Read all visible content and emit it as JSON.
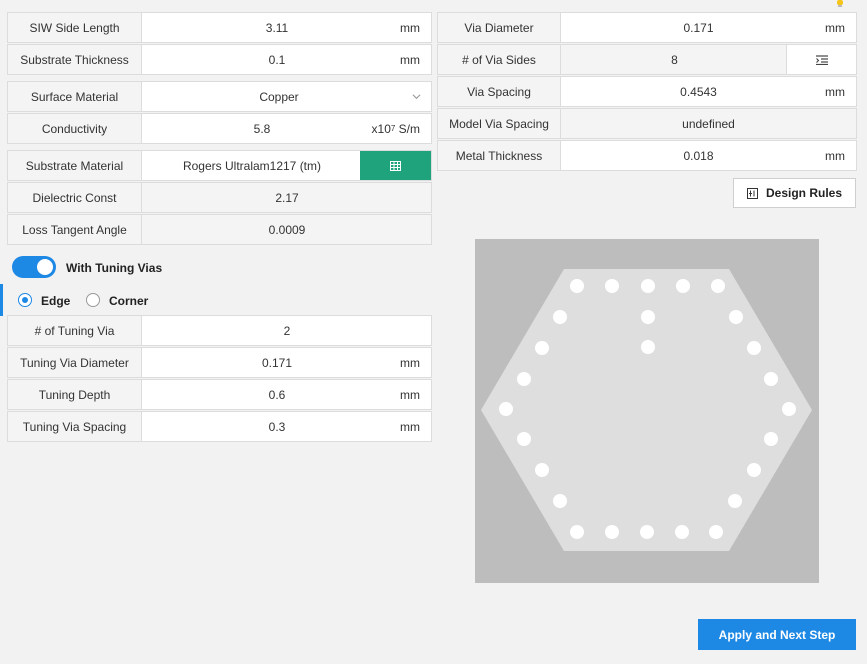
{
  "left": {
    "siw_side_length": {
      "label": "SIW Side Length",
      "value": "3.11",
      "unit": "mm"
    },
    "substrate_thickness": {
      "label": "Substrate Thickness",
      "value": "0.1",
      "unit": "mm"
    },
    "surface_material": {
      "label": "Surface Material",
      "value": "Copper"
    },
    "conductivity": {
      "label": "Conductivity",
      "value": "5.8",
      "unit_base": "x10",
      "unit_exp": "7",
      "unit_tail": " S/m"
    },
    "substrate_material": {
      "label": "Substrate Material",
      "value": "Rogers Ultralam1217 (tm)"
    },
    "dielectric_const": {
      "label": "Dielectric Const",
      "value": "2.17"
    },
    "loss_tangent": {
      "label": "Loss Tangent Angle",
      "value": "0.0009"
    }
  },
  "tuning": {
    "toggle_label": "With Tuning Vias",
    "toggle_on": true,
    "radio_edge": "Edge",
    "radio_corner": "Corner",
    "selected": "Edge",
    "num_tuning_via": {
      "label": "# of Tuning Via",
      "value": "2"
    },
    "tuning_via_diameter": {
      "label": "Tuning Via Diameter",
      "value": "0.171",
      "unit": "mm"
    },
    "tuning_depth": {
      "label": "Tuning Depth",
      "value": "0.6",
      "unit": "mm"
    },
    "tuning_via_spacing": {
      "label": "Tuning Via Spacing",
      "value": "0.3",
      "unit": "mm"
    }
  },
  "right": {
    "via_diameter": {
      "label": "Via Diameter",
      "value": "0.171",
      "unit": "mm"
    },
    "via_sides": {
      "label": "# of Via Sides",
      "value": "8"
    },
    "via_spacing": {
      "label": "Via Spacing",
      "value": "0.4543",
      "unit": "mm"
    },
    "model_via_spacing": {
      "label": "Model Via Spacing",
      "value": "undefined"
    },
    "metal_thickness": {
      "label": "Metal Thickness",
      "value": "0.018",
      "unit": "mm"
    }
  },
  "buttons": {
    "design_rules": "Design Rules",
    "apply_next": "Apply and Next Step"
  },
  "preview": {
    "background_color": "#bdbdbd",
    "hexagon_color": "#dedede",
    "via_color": "#ffffff"
  },
  "colors": {
    "accent": "#1e88e5",
    "green": "#1fa37c"
  }
}
